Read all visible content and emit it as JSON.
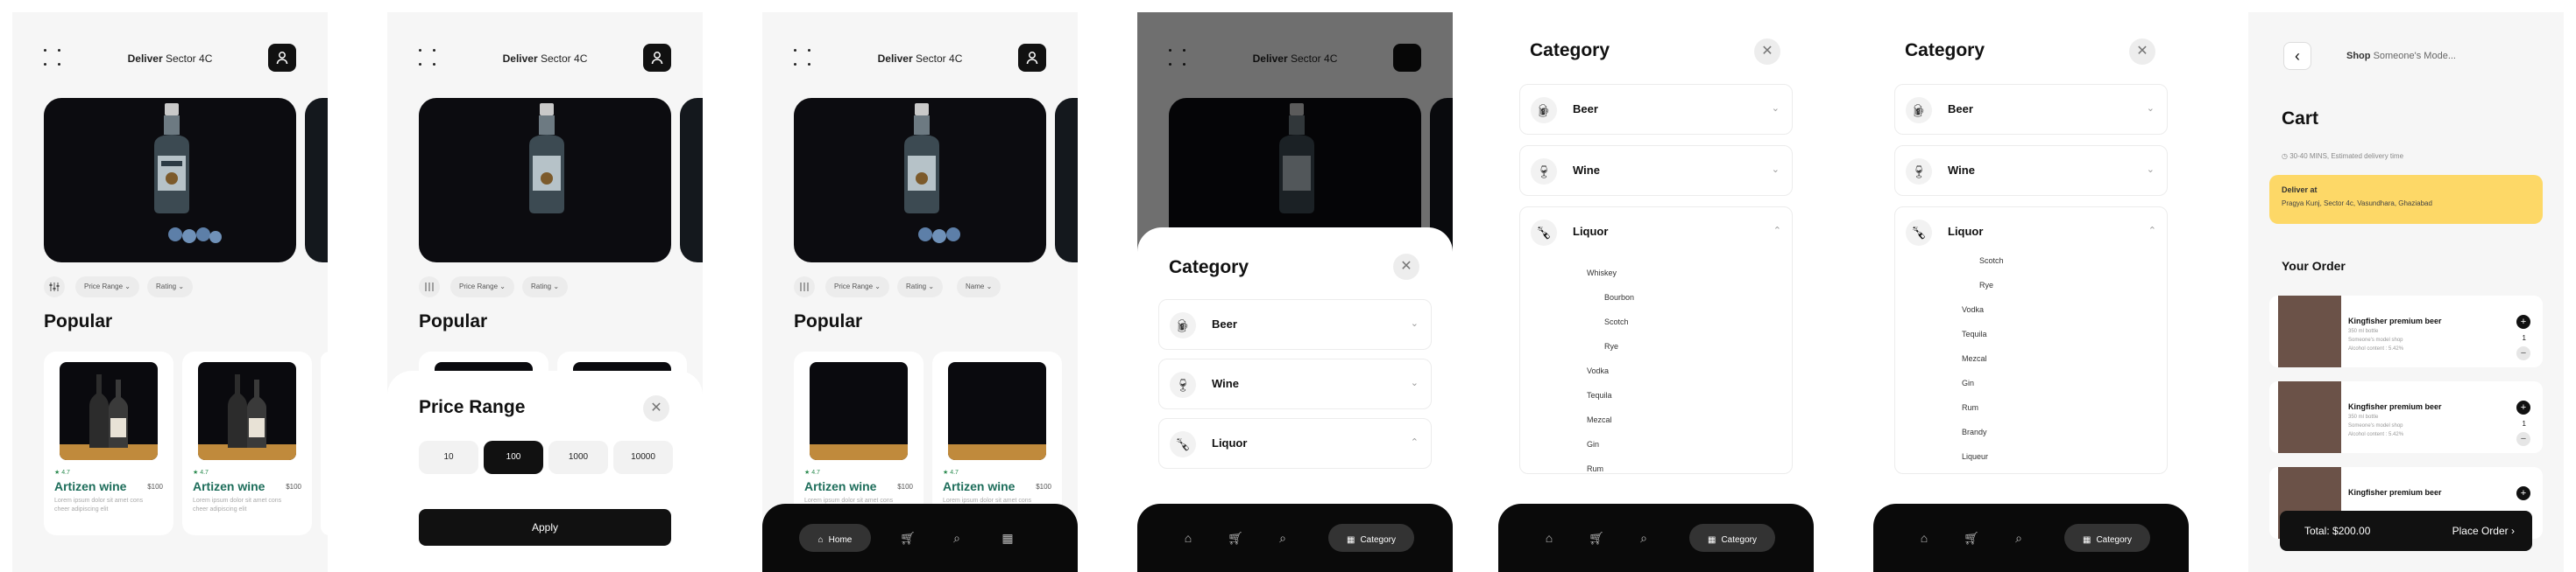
{
  "header": {
    "deliver_label": "Deliver",
    "location": "Sector 4C"
  },
  "filters": {
    "price_range": "Price Range",
    "rating": "Rating",
    "name": "Name"
  },
  "popular": {
    "title": "Popular",
    "products": [
      {
        "rating": "★ 4.7",
        "name": "Artizen wine",
        "price": "$100",
        "desc": "Lorem ipsum dolor sit amet cons cheer adipiscing elit"
      },
      {
        "rating": "★ 4.7",
        "name": "Artizen wine",
        "price": "$100",
        "desc": "Lorem ipsum dolor sit amet cons cheer adipiscing elit"
      }
    ]
  },
  "price_sheet": {
    "title": "Price Range",
    "options": [
      "10",
      "100",
      "1000",
      "10000"
    ],
    "selected": "100",
    "apply": "Apply"
  },
  "category_sheet": {
    "title": "Category",
    "categories": [
      "Beer",
      "Wine",
      "Liquor"
    ],
    "liquor_sub": [
      "Whiskey",
      "Bourbon",
      "Scotch",
      "Rye",
      "Vodka",
      "Tequila",
      "Mezcal",
      "Gin",
      "Rum"
    ],
    "liquor_sub_scrolled": [
      "Scotch",
      "Rye",
      "Vodka",
      "Tequila",
      "Mezcal",
      "Gin",
      "Rum",
      "Brandy",
      "Liqueur"
    ]
  },
  "nav": {
    "home": "Home",
    "category": "Category"
  },
  "cart": {
    "shop_label": "Shop",
    "shop_name": "Someone's Mode...",
    "title": "Cart",
    "eta": "30-40 MINS, Estimated delivery time",
    "deliver_at": "Deliver at",
    "address": "Pragya Kunj, Sector 4c, Vasundhara, Ghaziabad",
    "your_order": "Your Order",
    "items": [
      {
        "name": "Kingfisher premium beer",
        "size": "350 ml bottle",
        "shop": "Someone's model shop",
        "alc": "Alcohol content : 5.42%",
        "qty": "1"
      },
      {
        "name": "Kingfisher premium beer",
        "size": "350 ml bottle",
        "shop": "Someone's model shop",
        "alc": "Alcohol content : 5.42%",
        "qty": "1"
      },
      {
        "name": "Kingfisher premium beer"
      }
    ],
    "total": "Total: $200.00",
    "place_order": "Place Order"
  },
  "colors": {
    "accent": "#111111",
    "wine_name": "#1d6d5a",
    "address_card": "#fdd867",
    "rating": "#2a8a4e"
  }
}
